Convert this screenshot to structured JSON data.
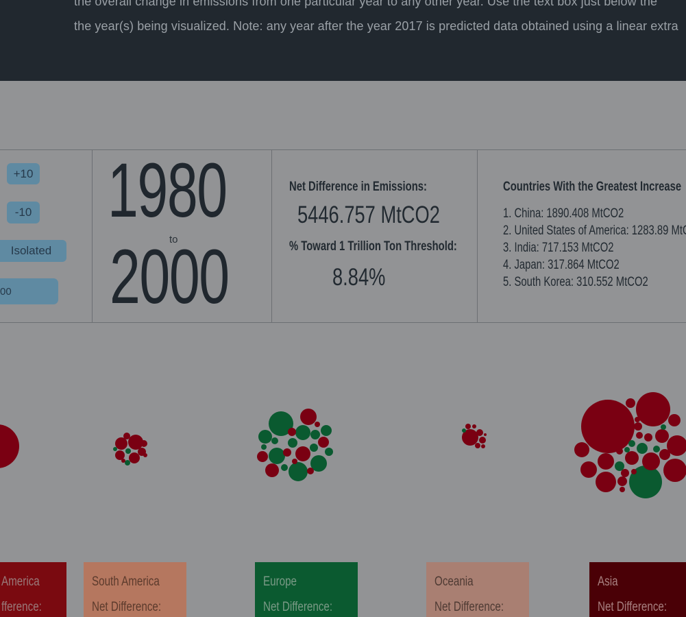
{
  "description": {
    "line1": "the overall change in emissions from one particular year to any other year. Use the text box just below the",
    "line2": "the year(s) being visualized. Note: any year after the year 2017 is predicted data obtained using a linear extra"
  },
  "controls": {
    "plus_label": "+10",
    "minus_label": "-10",
    "isolated_label": "Isolated",
    "year_input_value": "00"
  },
  "years": {
    "start": "1980",
    "connector": "to",
    "end": "2000"
  },
  "stats": {
    "net_diff_label": "Net Difference in Emissions:",
    "net_diff_value": "5446.757 MtCO2",
    "threshold_label": "% Toward 1 Trillion Ton Threshold:",
    "threshold_value": "8.84%"
  },
  "top_countries": {
    "title": "Countries With the Greatest Increase",
    "items": [
      "1. China: 1890.408 MtCO2",
      "2. United States of America: 1283.89 MtC",
      "3. India: 717.153 MtCO2",
      "4. Japan: 317.864 MtCO2",
      "5. South Korea: 310.552 MtCO2"
    ]
  },
  "colors": {
    "increase": "#7a0012",
    "decrease": "#0a5a30",
    "north_america_card": "#7a0a10",
    "south_america_card": "#b5775f",
    "europe_card": "#0b5a30",
    "oceania_card": "#a97f72",
    "asia_card": "#4a0006"
  },
  "continents": [
    {
      "name": "America",
      "diff_label": "fference:"
    },
    {
      "name": "South America",
      "diff_label": "Net Difference:"
    },
    {
      "name": "Europe",
      "diff_label": "Net Difference:"
    },
    {
      "name": "Oceania",
      "diff_label": "Net Difference:"
    },
    {
      "name": "Asia",
      "diff_label": "Net Difference:"
    }
  ]
}
